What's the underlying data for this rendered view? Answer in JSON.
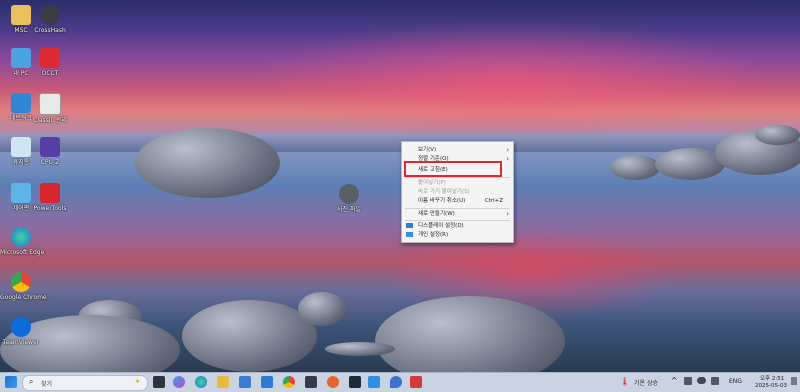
{
  "desktop_icons": [
    {
      "label": "MSC"
    },
    {
      "label": "CrossHash"
    },
    {
      "label": "내 PC"
    },
    {
      "label": "OCCT"
    },
    {
      "label": "네트워크"
    },
    {
      "label": "Classic 관리"
    },
    {
      "label": "휴지통"
    },
    {
      "label": "CPU-Z"
    },
    {
      "label": "제어판"
    },
    {
      "label": "PowerTools"
    },
    {
      "label": "Microsoft Edge"
    },
    {
      "label": "Google Chrome"
    },
    {
      "label": "TeamViewer"
    }
  ],
  "desktop_file": {
    "label": "사진 파일"
  },
  "context_menu": {
    "items": [
      {
        "label": "보기(V)",
        "shortcut": "",
        "submenu": true,
        "disabled": false
      },
      {
        "label": "정렬 기준(O)",
        "shortcut": "",
        "submenu": true,
        "disabled": false
      },
      {
        "label": "새로 고침(E)",
        "shortcut": "",
        "submenu": false,
        "disabled": false
      },
      {
        "label": "붙여넣기(P)",
        "shortcut": "",
        "submenu": false,
        "disabled": true
      },
      {
        "label": "바로 가기 붙여넣기(S)",
        "shortcut": "",
        "submenu": false,
        "disabled": true
      },
      {
        "label": "이름 바꾸기 취소(U)",
        "shortcut": "Ctrl+Z",
        "submenu": false,
        "disabled": false
      },
      {
        "label": "새로 만들기(W)",
        "shortcut": "",
        "submenu": true,
        "disabled": false
      },
      {
        "label": "디스플레이 설정(D)",
        "shortcut": "",
        "submenu": false,
        "disabled": false
      },
      {
        "label": "개인 설정(R)",
        "shortcut": "",
        "submenu": false,
        "disabled": false
      }
    ]
  },
  "taskbar": {
    "search_placeholder": "찾기",
    "weather_text": "기온 상승",
    "lang": "ENG",
    "time": "오후 2:51",
    "date": "2025-05-03"
  },
  "colors": {
    "highlight_border": "#e0262f",
    "taskbar_bg": "#c9d3e2"
  }
}
